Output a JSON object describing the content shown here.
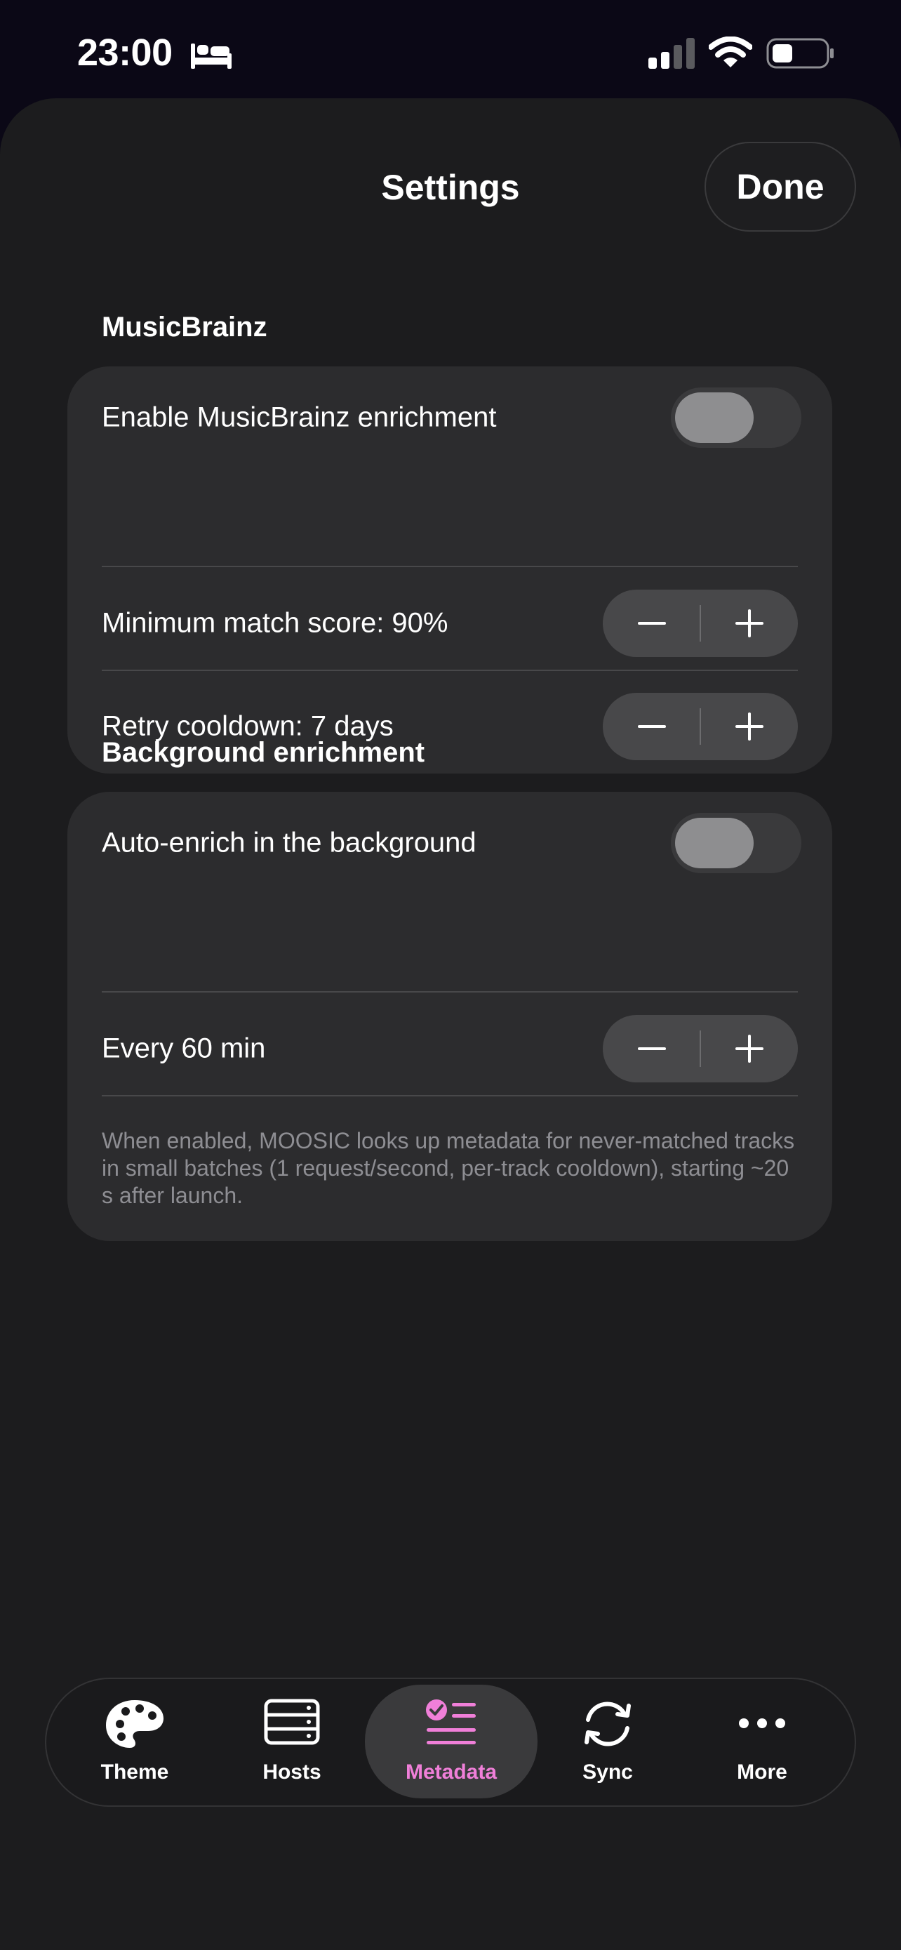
{
  "status_bar": {
    "time": "23:00",
    "icons": [
      "bed-icon",
      "cellular-signal-icon",
      "wifi-icon",
      "battery-icon"
    ]
  },
  "nav": {
    "title": "Settings",
    "done_label": "Done"
  },
  "sections": {
    "musicbrainz": {
      "title": "MusicBrainz",
      "enable_label": "Enable MusicBrainz enrichment",
      "enable_on": false,
      "min_score_label": "Minimum match score: 90%",
      "cooldown_label": "Retry cooldown: 7 days"
    },
    "background": {
      "title": "Background enrichment",
      "auto_label": "Auto-enrich in the background",
      "auto_on": false,
      "interval_label": "Every 60 min",
      "footnote": "When enabled, MOOSIC looks up metadata for never-matched tracks in small batches (1 request/second, per-track cooldown), starting ~20 s after launch."
    }
  },
  "tabs": [
    {
      "label": "Theme",
      "icon": "palette-icon",
      "active": false
    },
    {
      "label": "Hosts",
      "icon": "server-icon",
      "active": false
    },
    {
      "label": "Metadata",
      "icon": "checklist-icon",
      "active": true
    },
    {
      "label": "Sync",
      "icon": "sync-icon",
      "active": false
    },
    {
      "label": "More",
      "icon": "more-icon",
      "active": false
    }
  ],
  "colors": {
    "background": "#1c1c1e",
    "card": "#2c2c2e",
    "accent": "#f07fd9",
    "secondary_text": "#8e8e93"
  }
}
